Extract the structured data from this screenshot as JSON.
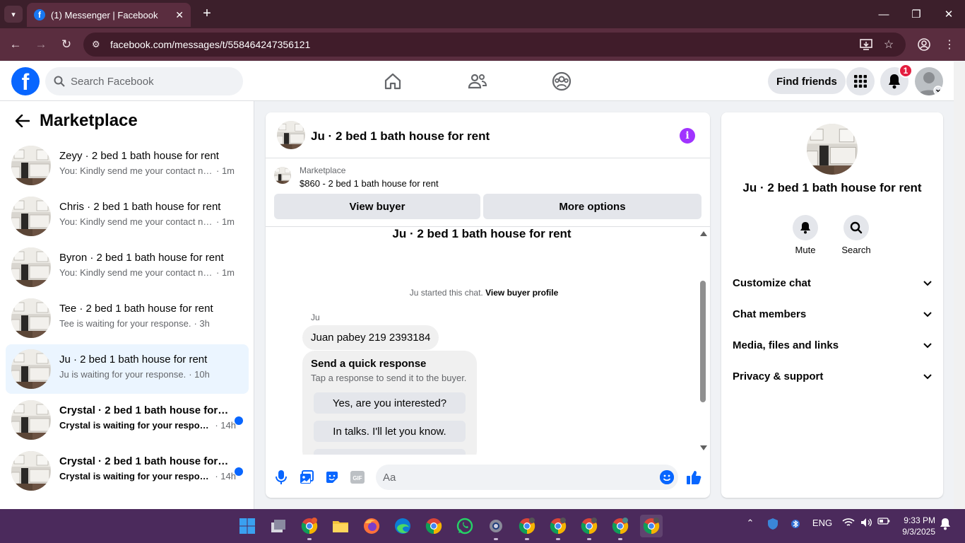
{
  "browser": {
    "tab_title": "(1) Messenger | Facebook",
    "url": "facebook.com/messages/t/558464247356121"
  },
  "header": {
    "logo": "f",
    "search_placeholder": "Search Facebook",
    "find_friends": "Find friends",
    "notification_count": "1"
  },
  "sidebar": {
    "title": "Marketplace",
    "conversations": [
      {
        "title": "Zeyy · 2 bed 1 bath house for rent",
        "snippet": "You: Kindly send me your contact nu...",
        "time": "· 1m",
        "unread": false,
        "active": false
      },
      {
        "title": "Chris · 2 bed 1 bath house for rent",
        "snippet": "You: Kindly send me your contact nu...",
        "time": "· 1m",
        "unread": false,
        "active": false
      },
      {
        "title": "Byron · 2 bed 1 bath house for rent",
        "snippet": "You: Kindly send me your contact nu...",
        "time": "· 1m",
        "unread": false,
        "active": false
      },
      {
        "title": "Tee · 2 bed 1 bath house for rent",
        "snippet": "Tee is waiting for your response.",
        "time": "· 3h",
        "unread": false,
        "active": false
      },
      {
        "title": "Ju · 2 bed 1 bath house for rent",
        "snippet": "Ju is waiting for your response.",
        "time": "· 10h",
        "unread": false,
        "active": true
      },
      {
        "title": "Crystal · 2 bed 1 bath house for r...",
        "snippet": "Crystal is waiting for your respon...",
        "time": "· 14h",
        "unread": true,
        "active": false
      },
      {
        "title": "Crystal · 2 bed 1 bath house for r...",
        "snippet": "Crystal is waiting for your respon...",
        "time": "· 14h",
        "unread": true,
        "active": false
      }
    ]
  },
  "chat": {
    "title": "Ju · 2 bed 1 bath house for rent",
    "marketplace_label": "Marketplace",
    "listing": "$860 - 2 bed 1 bath house for rent",
    "view_buyer": "View buyer",
    "more_options": "More options",
    "thread_title": "Ju · 2 bed 1 bath house for rent",
    "started_text": "Ju started this chat.",
    "view_buyer_profile": "View buyer profile",
    "sender": "Ju",
    "message": "Juan pabey 219 2393184",
    "quick_response_title": "Send a quick response",
    "quick_response_sub": "Tap a response to send it to the buyer.",
    "quick_responses": [
      "Yes, are you interested?",
      "In talks. I'll let you know."
    ],
    "composer_placeholder": "Aa"
  },
  "right_panel": {
    "name": "Ju · 2 bed 1 bath house for rent",
    "mute": "Mute",
    "search": "Search",
    "sections": [
      "Customize chat",
      "Chat members",
      "Media, files and links",
      "Privacy & support"
    ]
  },
  "taskbar": {
    "lang": "ENG",
    "time": "9:33 PM",
    "date": "9/3/2025"
  },
  "colors": {
    "fb_blue": "#0866ff",
    "chrome_tab": "#5a2d3f",
    "taskbar": "#4b2a5c"
  }
}
